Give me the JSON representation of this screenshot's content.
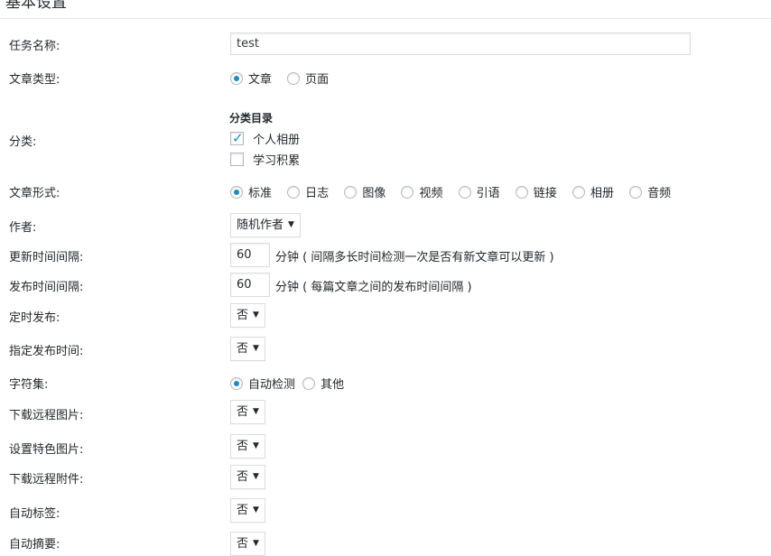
{
  "header": {
    "title": "基本设置"
  },
  "task_name": {
    "label": "任务名称:",
    "value": "test"
  },
  "post_type": {
    "label": "文章类型:",
    "options": [
      "文章",
      "页面"
    ],
    "selected": "文章"
  },
  "category": {
    "label": "分类:",
    "title": "分类目录",
    "items": [
      {
        "label": "个人相册",
        "checked": true
      },
      {
        "label": "学习积累",
        "checked": false
      }
    ]
  },
  "post_format": {
    "label": "文章形式:",
    "options": [
      "标准",
      "日志",
      "图像",
      "视频",
      "引语",
      "链接",
      "相册",
      "音频"
    ],
    "selected": "标准"
  },
  "author": {
    "label": "作者:",
    "value": "随机作者"
  },
  "update_interval": {
    "label": "更新时间间隔:",
    "value": "60",
    "hint": "分钟 ( 间隔多长时间检测一次是否有新文章可以更新 )"
  },
  "publish_interval": {
    "label": "发布时间间隔:",
    "value": "60",
    "hint": "分钟 ( 每篇文章之间的发布时间间隔 )"
  },
  "scheduled_publish": {
    "label": "定时发布:",
    "value": "否"
  },
  "specify_publish_time": {
    "label": "指定发布时间:",
    "value": "否"
  },
  "charset": {
    "label": "字符集:",
    "options": [
      "自动检测",
      "其他"
    ],
    "selected": "自动检测"
  },
  "download_remote_images": {
    "label": "下载远程图片:",
    "value": "否"
  },
  "featured_image": {
    "label": "设置特色图片:",
    "value": "否"
  },
  "download_remote_attachments": {
    "label": "下载远程附件:",
    "value": "否"
  },
  "auto_tags": {
    "label": "自动标签:",
    "value": "否"
  },
  "auto_excerpt": {
    "label": "自动摘要:",
    "value": "否"
  },
  "accent_color": "#1e8cbe"
}
